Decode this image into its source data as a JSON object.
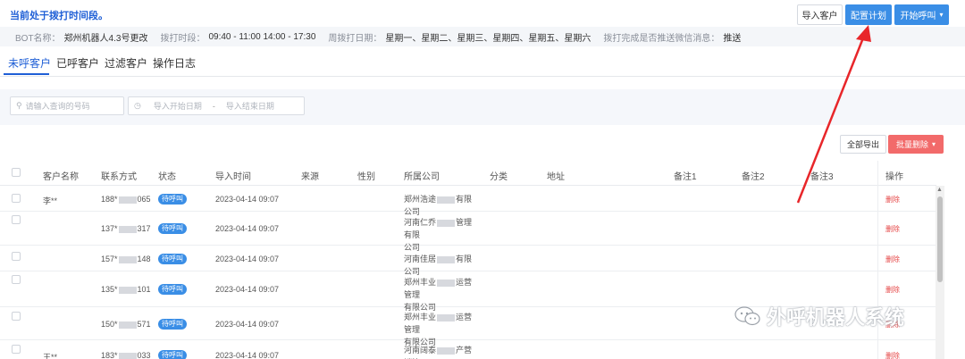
{
  "header": {
    "notice": "当前处于拨打时间段。",
    "import_label": "导入客户",
    "config_label": "配置计划",
    "call_label": "开始呼叫"
  },
  "info": {
    "bot_label": "BOT名称：",
    "bot_value": "郑州机器人4.3号更改",
    "time_label": "拨打时段：",
    "time_value": "09:40 - 11:00 14:00 - 17:30",
    "weekday_label": "周拨打日期：",
    "weekday_value": "星期一、星期二、星期三、星期四、星期五、星期六",
    "push_label": "拨打完成是否推送微信消息：",
    "push_value": "推送"
  },
  "tabs": [
    {
      "label": "未呼客户"
    },
    {
      "label": "已呼客户"
    },
    {
      "label": "过滤客户"
    },
    {
      "label": "操作日志"
    }
  ],
  "filters": {
    "search_placeholder": "请输入查询的号码",
    "start_placeholder": "导入开始日期",
    "separator": "-",
    "end_placeholder": "导入结束日期"
  },
  "actions": {
    "export_all": "全部导出",
    "batch_delete": "批量删除"
  },
  "table": {
    "columns": [
      "客户名称",
      "联系方式",
      "状态",
      "导入时间",
      "来源",
      "性别",
      "所属公司",
      "分类",
      "地址",
      "备注1",
      "备注2",
      "备注3",
      "操作"
    ],
    "rows": [
      {
        "name": "李**",
        "phone_prefix": "188*",
        "phone_suffix": "065",
        "status": "待呼叫",
        "time": "2023-04-14 09:07",
        "company_a": "郑州浩途",
        "company_b": "有限公司",
        "company_line2": "",
        "op": "删除"
      },
      {
        "name": "",
        "phone_prefix": "137*",
        "phone_suffix": "317",
        "status": "待呼叫",
        "time": "2023-04-14 09:07",
        "company_a": "河南仁乔",
        "company_b": "管理有限",
        "company_line2": "公司",
        "op": "删除"
      },
      {
        "name": "",
        "phone_prefix": "157*",
        "phone_suffix": "148",
        "status": "待呼叫",
        "time": "2023-04-14 09:07",
        "company_a": "河南佳居",
        "company_b": "有限公司",
        "company_line2": "",
        "op": "删除"
      },
      {
        "name": "",
        "phone_prefix": "135*",
        "phone_suffix": "101",
        "status": "待呼叫",
        "time": "2023-04-14 09:07",
        "company_a": "郑州丰业",
        "company_b": "运营管理",
        "company_line2": "有限公司",
        "op": "删除"
      },
      {
        "name": "",
        "phone_prefix": "150*",
        "phone_suffix": "571",
        "status": "待呼叫",
        "time": "2023-04-14 09:07",
        "company_a": "郑州丰业",
        "company_b": "运营管理",
        "company_line2": "有限公司",
        "op": "删除"
      },
      {
        "name": "王**",
        "phone_prefix": "183*",
        "phone_suffix": "033",
        "status": "待呼叫",
        "time": "2023-04-14 09:07",
        "company_a": "河南阔泰",
        "company_b": "产营销策",
        "company_line2": "",
        "op": "删除"
      }
    ]
  },
  "watermark": {
    "text": "外呼机器人系统"
  },
  "colors": {
    "primary": "#3a8ee6",
    "danger": "#f26a6a",
    "arrow": "#e8262a"
  }
}
